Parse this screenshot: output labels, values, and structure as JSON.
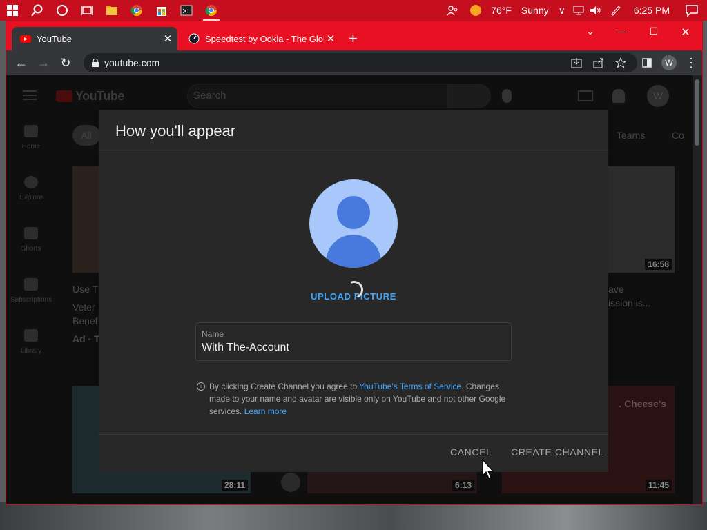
{
  "taskbar": {
    "weather_temp": "76°F",
    "weather_cond": "Sunny",
    "time": "6:25 PM"
  },
  "browser": {
    "tabs": [
      {
        "title": "YouTube",
        "active": true
      },
      {
        "title": "Speedtest by Ookla - The Global",
        "active": false
      }
    ],
    "url": "youtube.com",
    "profile_initial": "W"
  },
  "youtube": {
    "search_placeholder": "Search",
    "nav": [
      "Home",
      "Explore",
      "Shorts",
      "Subscriptions",
      "Library"
    ],
    "chips": [
      "All",
      "Teams",
      "Co"
    ],
    "profile_initial": "W",
    "bg_text_left": [
      "Use Th",
      "Veter",
      "Benef",
      "Ad · T"
    ],
    "bg_text_right": [
      "ave",
      "ission is..."
    ],
    "thumb_right_caption": ". Cheese's",
    "durations": [
      "16:58",
      "28:11",
      "6:13",
      "11:45"
    ]
  },
  "modal": {
    "title": "How you'll appear",
    "upload_label": "UPLOAD PICTURE",
    "name_label": "Name",
    "name_value": "With The-Account",
    "info_pre": "By clicking Create Channel you agree to ",
    "info_link_terms": "YouTube's Terms of Service",
    "info_mid": ". Changes made to your name and avatar are visible only on YouTube and not other Google services. ",
    "info_link_learn": "Learn more",
    "cancel_label": "CANCEL",
    "create_label": "CREATE CHANNEL"
  },
  "colors": {
    "accent": "#3ea6ff",
    "window_red": "#e81123",
    "taskbar_red": "#c50f1f"
  }
}
